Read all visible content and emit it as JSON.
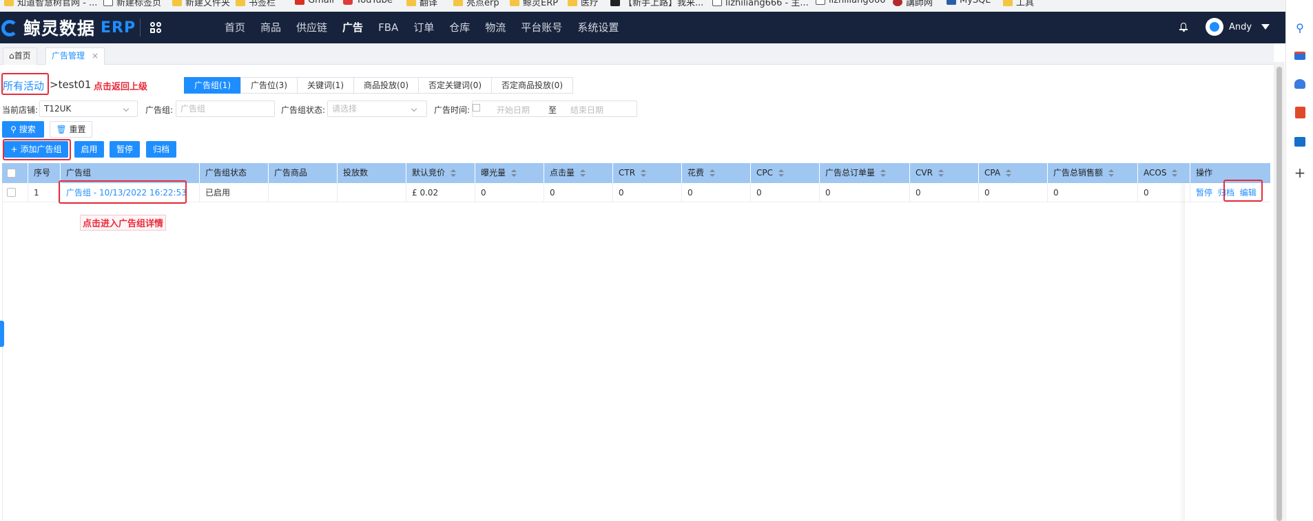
{
  "bookmarks": [
    {
      "label": "知道智慧树官网 - ...",
      "icon": "folder-icon"
    },
    {
      "label": "新建标签页",
      "icon": "page-icon"
    },
    {
      "label": "新建文件夹",
      "icon": "folder-icon"
    },
    {
      "label": "书签栏",
      "icon": "folder-icon"
    },
    {
      "label": "Gmail",
      "icon": "gmail-icon"
    },
    {
      "label": "YouTube",
      "icon": "youtube-icon"
    },
    {
      "label": "翻译",
      "icon": "folder-icon"
    },
    {
      "label": "亮点erp",
      "icon": "folder-icon"
    },
    {
      "label": "鲸灵ERP",
      "icon": "folder-icon"
    },
    {
      "label": "医疗",
      "icon": "folder-icon"
    },
    {
      "label": "【新手上路】我来...",
      "icon": "page-icon"
    },
    {
      "label": "lizhiliang666 - 主...",
      "icon": "page-icon"
    },
    {
      "label": "lizhiliang666",
      "icon": "page-icon"
    },
    {
      "label": "講師网",
      "icon": "page-icon"
    },
    {
      "label": "MySQL",
      "icon": "page-icon"
    },
    {
      "label": "工具",
      "icon": "folder-icon"
    }
  ],
  "app": {
    "logo_text": "鲸灵数据",
    "logo_erp": "ERP",
    "nav": [
      "首页",
      "商品",
      "供应链",
      "广告",
      "FBA",
      "订单",
      "仓库",
      "物流",
      "平台账号",
      "系统设置"
    ],
    "nav_active": "广告",
    "user_name": "Andy"
  },
  "page_tabs": {
    "home": "首页",
    "current": "广告管理",
    "close": "×"
  },
  "breadcrumb": {
    "all": "所有活动",
    "sep_current": ">test01",
    "annotation": "点击返回上级"
  },
  "sub_tabs": [
    {
      "label": "广告组(1)",
      "active": true
    },
    {
      "label": "广告位(3)",
      "active": false
    },
    {
      "label": "关键词(1)",
      "active": false
    },
    {
      "label": "商品投放(0)",
      "active": false
    },
    {
      "label": "否定关键词(0)",
      "active": false
    },
    {
      "label": "否定商品投放(0)",
      "active": false
    }
  ],
  "filters": {
    "store_label": "当前店铺:",
    "store_value": "T12UK",
    "group_label": "广告组:",
    "group_placeholder": "广告组",
    "status_label": "广告组状态:",
    "status_placeholder": "请选择",
    "time_label": "广告时间:",
    "start_placeholder": "开始日期",
    "to": "至",
    "end_placeholder": "结束日期"
  },
  "buttons": {
    "search": "搜索",
    "reset": "重置",
    "add_group": "添加广告组",
    "enable": "启用",
    "pause": "暂停",
    "archive": "归档"
  },
  "table": {
    "headers": [
      "序号",
      "广告组",
      "广告组状态",
      "广告商品",
      "投放数",
      "默认竞价",
      "曝光量",
      "点击量",
      "CTR",
      "花费",
      "CPC",
      "广告总订单量",
      "CVR",
      "CPA",
      "广告总销售额",
      "ACOS",
      "操作"
    ],
    "rows": [
      {
        "index": "1",
        "name": "广告组 - 10/13/2022 16:22:53",
        "status": "已启用",
        "product": "",
        "targets": "",
        "bid": "£ 0.02",
        "impressions": "0",
        "clicks": "0",
        "ctr": "0",
        "spend": "0",
        "cpc": "0",
        "orders": "0",
        "cvr": "0",
        "cpa": "0",
        "sales": "0",
        "acos": "0",
        "ops": [
          "暂停",
          "归档",
          "编辑"
        ]
      }
    ],
    "annotation": "点击进入广告组详情"
  },
  "colors": {
    "nav_bg": "#17233d",
    "accent": "#1e8eff",
    "header_bg": "#9fc7f2",
    "annotation": "#e82a3a"
  }
}
